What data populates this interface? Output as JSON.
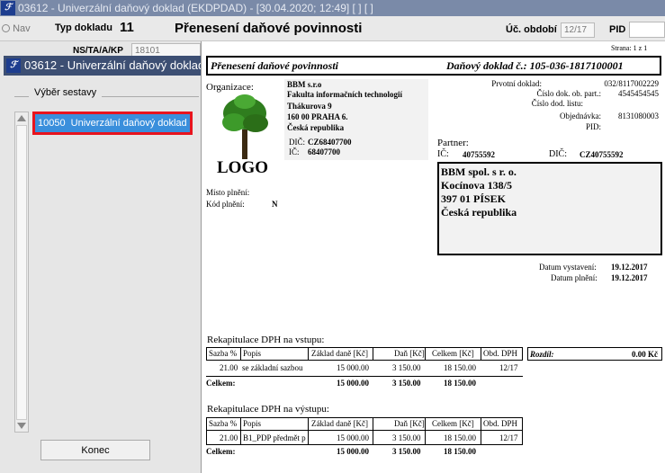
{
  "window": {
    "title": "03612 - Univerzální daňový doklad (EKDPDAD) - [30.04.2020; 12:49]  [  ]  [  ]"
  },
  "topbar": {
    "nav_label": "Nav",
    "typ_label": "Typ dokladu",
    "typ_value": "11",
    "doc_title": "Přenesení daňové povinnosti",
    "obdobi_label": "Úč. období",
    "obdobi_value": "12/17",
    "pid_label": "PID",
    "ns_label": "NS/TA/A/KP",
    "ns_value": "18101"
  },
  "left": {
    "header": "03612 - Univerzální daňový doklad",
    "vyber_label": "Výběr sestavy",
    "item_code": "10050",
    "item_label": "Univerzální daňový doklad",
    "konec": "Konec"
  },
  "report": {
    "page": "Strana: 1 z 1",
    "title": "Přenesení daňové povinnosti",
    "doc_number": "Daňový doklad č.: 105-036-1817100001",
    "org_label": "Organizace:",
    "org_lines": [
      "BBM s.r.o",
      "Fakulta informačních technologií",
      "Thákurova 9",
      "160 00 PRAHA 6.",
      "Česká republika"
    ],
    "logo_text": "LOGO",
    "dic_label": "DIČ:",
    "dic_value": "CZ68407700",
    "ic_label": "IČ:",
    "ic_value": "68407700",
    "meta": [
      {
        "label": "Prvotní doklad:",
        "value": "032/8117002229"
      },
      {
        "label": "Číslo dok. ob. part.:",
        "value": "4545454545"
      },
      {
        "label": "Číslo dod. listu:",
        "value": ""
      },
      {
        "label": "Objednávka:",
        "value": "8131080003"
      },
      {
        "label": "PID:",
        "value": ""
      }
    ],
    "partner_label": "Partner:",
    "p_ic_label": "IČ:",
    "p_ic_value": "40755592",
    "p_dic_label": "DIČ:",
    "p_dic_value": "CZ40755592",
    "partner_lines": [
      "BBM spol. s r. o.",
      "Kocínova 138/5",
      "397 01 PÍSEK",
      "Česká republika"
    ],
    "misto_label": "Místo plnění:",
    "kod_label": "Kód plnění:",
    "kod_value": "N",
    "datum_vyst_label": "Datum vystavení:",
    "datum_vyst_value": "19.12.2017",
    "datum_pln_label": "Datum plnění:",
    "datum_pln_value": "19.12.2017",
    "vstup_title": "Rekapitulace DPH na vstupu:",
    "vystup_title": "Rekapitulace DPH na výstupu:",
    "cols": [
      "Sazba %",
      "Popis",
      "Základ daně [Kč]",
      "Daň [Kč]",
      "Celkem [Kč]",
      "Obd. DPH"
    ],
    "vstup_row": [
      "21.00",
      "se základní sazbou",
      "15 000.00",
      "3 150.00",
      "18 150.00",
      "12/17"
    ],
    "vstup_total": [
      "Celkem:",
      "15 000.00",
      "3 150.00",
      "18 150.00"
    ],
    "rozdil_label": "Rozdíl:",
    "rozdil_value": "0.00 Kč",
    "vystup_row": [
      "21.00",
      "B1_PDP předmět p",
      "15 000.00",
      "3 150.00",
      "18 150.00",
      "12/17"
    ],
    "vystup_total": [
      "Celkem:",
      "15 000.00",
      "3 150.00",
      "18 150.00"
    ]
  }
}
